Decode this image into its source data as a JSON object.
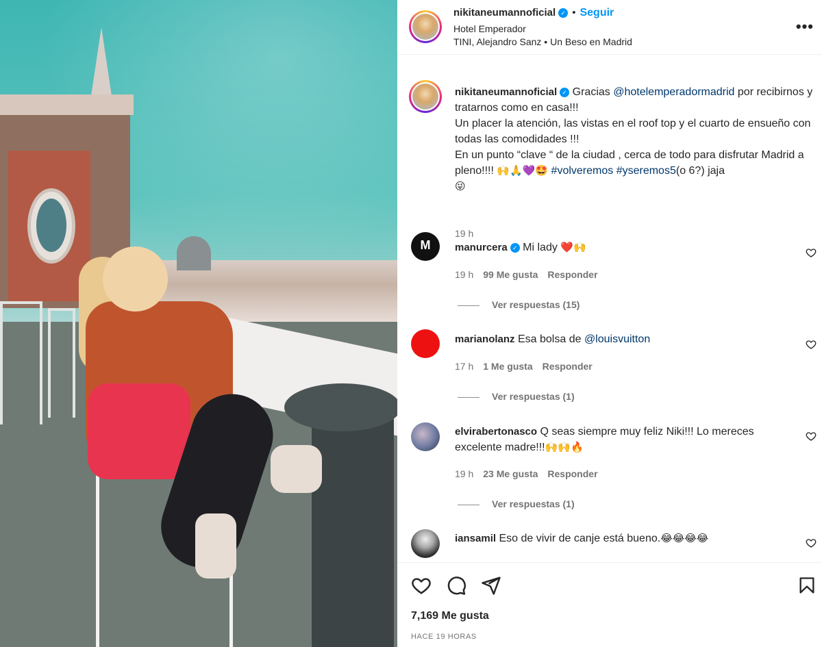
{
  "post": {
    "username": "nikitaneumannoficial",
    "verified_mark": "✓",
    "separator": "•",
    "follow_label": "Seguir",
    "location": "Hotel Emperador",
    "audio": "TINI, Alejandro Sanz • Un Beso en Madrid",
    "more_label": "•••"
  },
  "caption": {
    "username": "nikitaneumannoficial",
    "text_1": "Gracias ",
    "mention": "@hotelemperadormadrid",
    "text_2": " por recibirnos y tratarnos como en casa!!!",
    "line_2": "Un placer la atención, las vistas en el roof top y el cuarto de ensueño con todas las comodidades !!!",
    "line_3": "En un punto “clave “ de la ciudad , cerca de todo para disfrutar Madrid a pleno!!!! ",
    "emojis_1": "🙌🙏💜🤩",
    "tag_1": "#volveremos",
    "tag_2": "#yseremos5",
    "text_3": "(o 6?) jaja ",
    "emojis_2": "😜",
    "time": "19 h"
  },
  "comments": [
    {
      "username": "manurcera",
      "verified": true,
      "text": "Mi lady ",
      "emojis": "❤️🙌",
      "time": "19 h",
      "likes": "99 Me gusta",
      "reply": "Responder",
      "replies": "Ver respuestas (15)"
    },
    {
      "username": "marianolanz",
      "verified": false,
      "text": "Esa bolsa de ",
      "mention": "@louisvuitton",
      "time": "17 h",
      "likes": "1 Me gusta",
      "reply": "Responder",
      "replies": "Ver respuestas (1)"
    },
    {
      "username": "elvirabertonasco",
      "verified": false,
      "text": "Q seas siempre muy feliz Niki!!! Lo mereces excelente madre!!!",
      "emojis": "🙌🙌🔥",
      "time": "19 h",
      "likes": "23 Me gusta",
      "reply": "Responder",
      "replies": "Ver respuestas (1)"
    },
    {
      "username": "iansamil",
      "verified": false,
      "text": "Eso de vivir de canje está bueno.",
      "emojis": "😂😂😂😂"
    }
  ],
  "footer": {
    "likes_total": "7,169 Me gusta",
    "posted_ago": "HACE 19 HORAS"
  },
  "icons": {
    "like": "heart-icon",
    "comment": "comment-icon",
    "share": "paper-plane-icon",
    "save": "bookmark-icon",
    "more": "more-options-icon"
  },
  "colors": {
    "link": "#00376b",
    "follow": "#0095f6",
    "secondary_text": "#737373",
    "heart_red": "#ed4956"
  }
}
